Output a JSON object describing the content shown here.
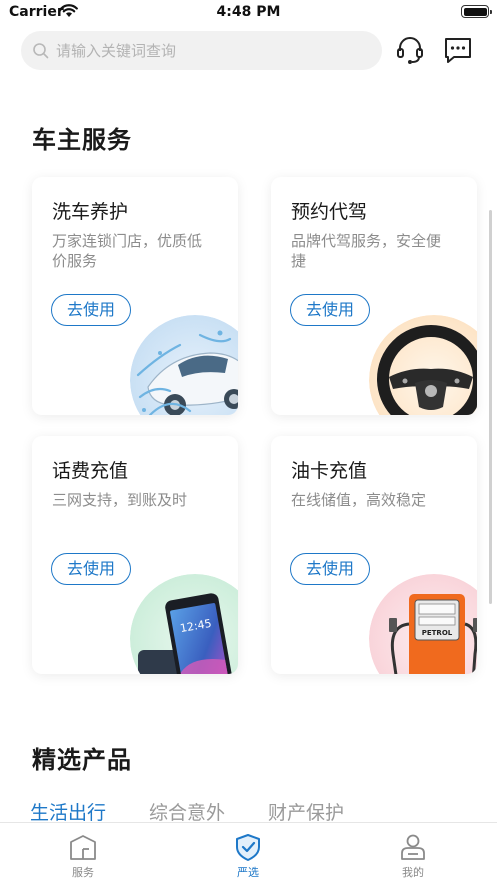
{
  "status_bar": {
    "carrier": "Carrier",
    "time": "4:48 PM"
  },
  "search": {
    "placeholder": "请输入关键词查询"
  },
  "header_icons": [
    "headset-icon",
    "message-icon"
  ],
  "owner_services": {
    "title": "车主服务",
    "cards": [
      {
        "title": "洗车养护",
        "desc": "万家连锁门店，优质低价服务",
        "button": "去使用",
        "art": "car-wash-image"
      },
      {
        "title": "预约代驾",
        "desc": "品牌代驾服务，安全便捷",
        "button": "去使用",
        "art": "steering-wheel-image"
      },
      {
        "title": "话费充值",
        "desc": "三网支持，到账及时",
        "button": "去使用",
        "art": "smartphone-image"
      },
      {
        "title": "油卡充值",
        "desc": "在线储值，高效稳定",
        "button": "去使用",
        "art": "fuel-pump-image"
      }
    ]
  },
  "featured": {
    "title": "精选产品",
    "tabs": [
      "生活出行",
      "综合意外",
      "财产保护"
    ],
    "active_tab": 0
  },
  "tabbar": {
    "items": [
      {
        "label": "服务",
        "icon": "house-icon"
      },
      {
        "label": "严选",
        "icon": "shield-check-icon"
      },
      {
        "label": "我的",
        "icon": "user-icon"
      }
    ],
    "active_index": 1
  },
  "colors": {
    "accent": "#1e78c8",
    "text_primary": "#1a1a1a",
    "text_secondary": "#8c8c8c"
  },
  "fuel_pump_label": "PETROL",
  "phone_clock": "12:45"
}
